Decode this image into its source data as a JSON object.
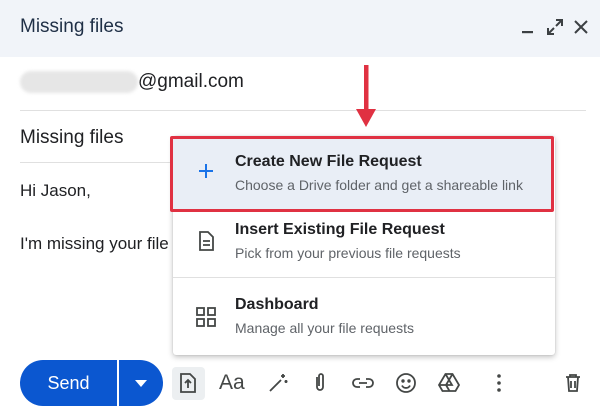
{
  "compose": {
    "title": "Missing files",
    "to_domain": "@gmail.com",
    "subject": "Missing files",
    "body_line1": "Hi Jason,",
    "body_line2": "I'm missing your file"
  },
  "menu": {
    "items": [
      {
        "title": "Create New File Request",
        "subtitle": "Choose a Drive folder and get a shareable link",
        "icon": "plus-icon"
      },
      {
        "title": "Insert Existing File Request",
        "subtitle": "Pick from your previous file requests",
        "icon": "document-icon"
      },
      {
        "title": "Dashboard",
        "subtitle": "Manage all your file requests",
        "icon": "grid-icon"
      }
    ]
  },
  "toolbar": {
    "send_label": "Send",
    "format_label": "Aa"
  },
  "colors": {
    "accent": "#0b57d0",
    "highlight_border": "#e03142"
  }
}
